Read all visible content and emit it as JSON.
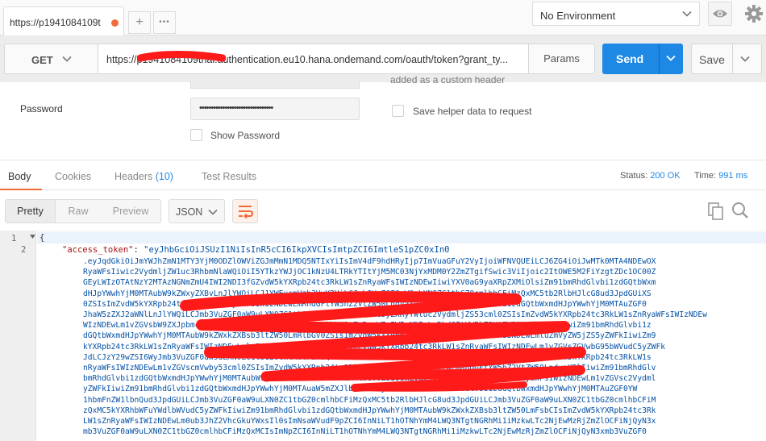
{
  "tabs": [
    {
      "title": "https://p1941084109t"
    }
  ],
  "tab_bar": {
    "add_label": "+",
    "more_label": "•••"
  },
  "environment": {
    "selected": "No Environment"
  },
  "request": {
    "method": "GET",
    "url": "https://p1941084109trial.authentication.eu10.hana.ondemand.com/oauth/token?grant_ty...",
    "params_label": "Params",
    "send_label": "Send",
    "save_label": "Save"
  },
  "auth": {
    "custom_header_note": "added as a custom header",
    "password_label": "Password",
    "password_value": "••••••••••••••••••••••••••••••••",
    "show_password_label": "Show Password",
    "save_helper_label": "Save helper data to request"
  },
  "response_tabs": {
    "body": "Body",
    "cookies": "Cookies",
    "headers": "Headers",
    "headers_count": "(10)",
    "test_results": "Test Results"
  },
  "response_status": {
    "status_label": "Status:",
    "status_value": "200 OK",
    "time_label": "Time:",
    "time_value": "991 ms"
  },
  "body_toolbar": {
    "pretty": "Pretty",
    "raw": "Raw",
    "preview": "Preview",
    "language": "JSON"
  },
  "code": {
    "line_numbers": [
      "1",
      "2"
    ],
    "open_brace": "{",
    "key": "\"access_token\"",
    "colon": ": ",
    "value_first": "\"eyJhbGciOiJSUzI1NiIsInR5cCI6IkpXVCIsImtpZCI6ImtleS1pZC0xIn0",
    "token_lines": [
      ".eyJqdGkiOiJmYWJhZmN1MTY3YjM0ODZlOWViZGJmMmN1MDQ5NTIxYiIsImV4dF9hdHRyIjp7ImVuaGFuY2VyIjoiWFNVQUEiLCJ6ZG4iOiJwMTk0MTA4NDEwOX",
      "RyaWFsIiwic2VydmljZW1uc3RhbmNlaWQiOiI5YTkzYWJjOC1kNzU4LTRkYTItYjM5MC03NjYxMDM0Y2ZmZTgifSwic3ViIjoic2ItOWE5M2FiYzgtZDc1OC00Z",
      "GEyLWIzOTAtNzY2MTAzNGNmZmU4IWI2NDI3fGZvdW5kYXRpb24tc3RkLW1sZnRyaWFsIWIzNDEwIiwiYXV0aG9yaXRpZXMiOlsiZm91bmRhdGlvbi1zdGQtbWxm",
      "dHJpYWwhYjM0MTAubW9kZWxyZXBvLnJlYWQiLCJ1YWEucmVzb3VyY2UiLCJmb3VuZGF0aW9uLXN0ZC1tbGZ0cmlhbCFiMzQxMC5tb2RlbHJlcG8ud3JpdGUiXS",
      "0ZSIsImZvdW5kYXRpb24tc3RkLW1sZnRyaWFsIWIzNDEwLmRhdGFtYW5hZ2VtZW50LndyaXRlIiwiZm91bmRhdGlvbi1zdGQtbWxmdHJpYWwhYjM0MTAuZGF0",
      "JhaW5zZXJ2aWNlLnJlYWQiLCJmb3VuZGF0aW9uLXN0ZC1tbGZ0cmlhbCFiMzQxMC5yZXRyYWluc2VydmljZS53cml0ZSIsImZvdW5kYXRpb24tc3RkLW1sZnRyaWFsIWIzNDEw",
      "WIzNDEwLm1vZGVsbW9ZXJpbmcucmVhZCIsImZvdW5kYXRpb24tc3RkLW1sZnRyaWFsIWIzNDEwLmRhdGFtYW5hZ2VtZW50LndyaXRlIiwiZm91bmRhdGlvbi1z",
      "dGQtbWxmdHJpYWwhYjM0MTAubW9kZWxkZXBsb3ltZW50LmRlbGV0ZSIsImZvdW5kYXRpb24tc3RkLW1sZnRyaWFsIWIzNDEwLmluZmVyZW5jZS5yZWFkIiwiZm9",
      "kYXRpb24tc3RkLW1sZnRyaWFsIWIzNDEwLmluZmVyZW5jZS53cml0ZSIsImZvdW5kYXRpb24tc3RkLW1sZnRyaWFsIWIzNDEwLm1vZGVsZGVwbG95bWVudC5yZWFk",
      "JdLCJzY29wZSI6WyJmb3VuZGF0aW9uLXN0ZC1tbGZ0cmlhbCFiMzQxMC5tb2RlbHJlcG8ucmVhZCIsInVhYS5yZXNvdXJjZSIsImZvdW5kYXRpb24tc3RkLW1s",
      "nRyaWFsIWIzNDEwLm1vZGVscmVwby53cml0ZSIsImZvdW5kYXRpb24tc3RkLW1sZnRyaWFsIWIzNDEwLmRhdGFtYW5hZ2VtZW50LndyaXRlIiwiZm91bmRhdGlv",
      "bmRhdGlvbi1zdGQtbWxmdHJpYWwhYjM0MTAubW9kZWxkZXBsb3ltZW50LmRlbGV0ZSIsImZvdW5kYXRpb24tc3RkLW1sZnRyaWFsIWIzNDEwLm1vZGVsc2Vydml",
      "yZWFkIiwiZm91bmRhdGlvbi1zdGQtbWxmdHJpYWwhYjM0MTAuaW5mZXJlbmNlLndyaXRlIiwiZm91bmRhdGlvbi1zdGQtbWxmdHJpYWwhYjM0MTAuZGF0YW",
      "1hbmFnZW1lbnQud3JpdGUiLCJmb3VuZGF0aW9uLXN0ZC1tbGZ0cmlhbCFiMzQxMC5tb2RlbHJlcG8ud3JpdGUiLCJmb3VuZGF0aW9uLXN0ZC1tbGZ0cmlhbCFiM",
      "zQxMC5kYXRhbWFuYWdlbWVudC5yZWFkIiwiZm91bmRhdGlvbi1zdGQtbWxmdHJpYWwhYjM0MTAubW9kZWxkZXBsb3ltZW50LmFsbCIsImZvdW5kYXRpb24tc3Rk",
      "LW1sZnRyaWFsIWIzNDEwLm0ub3JhZ2VhcGkuYWxsIl0sImNsaWVudF9pZCI6InNiLT1hOTNhYmM4LWQ3NTgtNGRhMi1iMzkwLTc2NjEwMzRjZmZlOCFiNjQyN3x",
      "mb3VuZGF0aW9uLXN0ZC1tbGZ0cmlhbCFiMzQxMCIsImNpZCI6InNiLT1hOTNhYmM4LWQ3NTgtNGRhMi1iMzkwLTc2NjEwMzRjZmZlOCFiNjQyN3xmb3VuZGF0"
    ]
  }
}
